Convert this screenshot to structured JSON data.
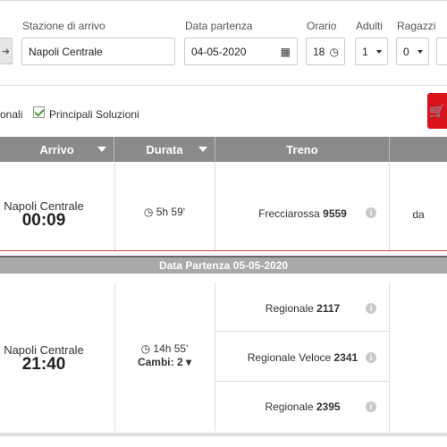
{
  "search": {
    "arrival_label": "Stazione di arrivo",
    "arrival_value": "Napoli Centrale",
    "departure_date_label": "Data partenza",
    "departure_date_value": "04-05-2020",
    "time_label": "Orario",
    "time_value": "18",
    "adults_label": "Adulti",
    "adults_value": "1",
    "children_label": "Ragazzi",
    "children_value": "0"
  },
  "filters": {
    "partial_label": "onali",
    "main_solutions_label": "Principali Soluzioni"
  },
  "table": {
    "headers": {
      "arrival": "Arrivo",
      "duration": "Durata",
      "train": "Treno"
    },
    "rows": [
      {
        "station": "Napoli Centrale",
        "time": "00:09",
        "duration": "5h 59'",
        "trains": [
          {
            "name": "Frecciarossa",
            "number": "9559"
          }
        ],
        "price": "da"
      }
    ],
    "date_band": "Data Partenza 05-05-2020",
    "rows2": [
      {
        "station": "Napoli Centrale",
        "time": "21:40",
        "duration": "14h 55'",
        "changes": "Cambi: 2",
        "trains": [
          {
            "name": "Regionale",
            "number": "2117"
          },
          {
            "name": "Regionale Veloce",
            "number": "2341"
          },
          {
            "name": "Regionale",
            "number": "2395"
          }
        ]
      }
    ]
  }
}
